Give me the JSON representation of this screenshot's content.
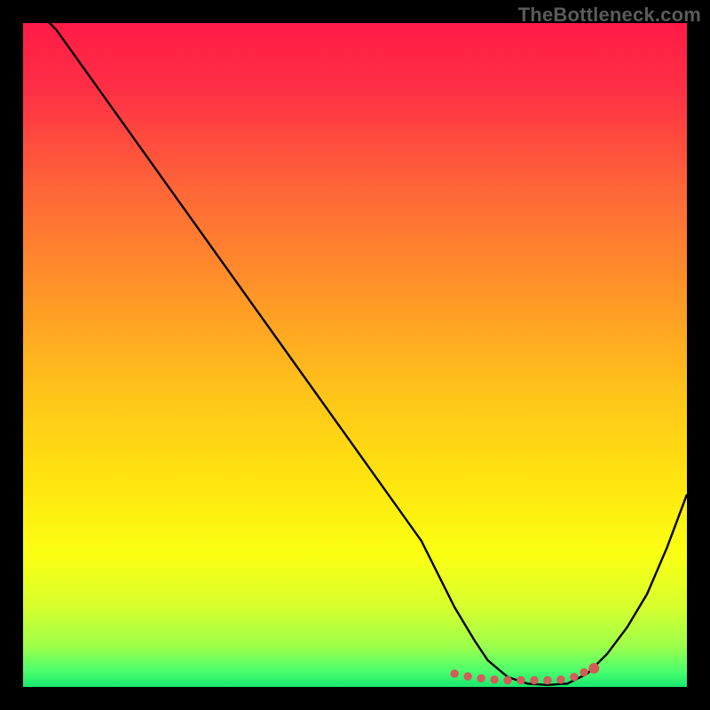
{
  "watermark": "TheBottleneck.com",
  "chart_data": {
    "type": "line",
    "title": "",
    "xlabel": "",
    "ylabel": "",
    "xlim": [
      0,
      100
    ],
    "ylim": [
      0,
      100
    ],
    "series": [
      {
        "name": "bottleneck-curve",
        "x": [
          0,
          5,
          10,
          15,
          20,
          25,
          30,
          35,
          40,
          45,
          50,
          55,
          60,
          63,
          65,
          68,
          70,
          73,
          76,
          79,
          82,
          85,
          88,
          91,
          94,
          97,
          100
        ],
        "y": [
          104,
          99,
          92,
          85,
          78,
          71,
          64,
          57,
          50,
          43,
          36,
          29,
          22,
          16,
          12,
          7,
          4,
          1.5,
          0.5,
          0.3,
          0.5,
          2,
          5,
          9,
          14,
          21,
          29
        ]
      }
    ],
    "optimal_band": {
      "x_start": 65,
      "x_end": 85,
      "y": 1.0
    },
    "markers": {
      "name": "optimal-range-markers",
      "x": [
        65,
        67,
        69,
        71,
        73,
        75,
        77,
        79,
        81,
        83,
        84.5,
        86
      ],
      "y": [
        2.0,
        1.6,
        1.3,
        1.1,
        1.0,
        1.0,
        1.0,
        1.0,
        1.1,
        1.5,
        2.2,
        2.8
      ]
    },
    "gradient_stops": [
      {
        "offset": 0.0,
        "color": "#ff1b47"
      },
      {
        "offset": 0.1,
        "color": "#ff2f45"
      },
      {
        "offset": 0.25,
        "color": "#ff6638"
      },
      {
        "offset": 0.4,
        "color": "#ff9328"
      },
      {
        "offset": 0.55,
        "color": "#ffc21a"
      },
      {
        "offset": 0.7,
        "color": "#ffe70f"
      },
      {
        "offset": 0.8,
        "color": "#faff12"
      },
      {
        "offset": 0.88,
        "color": "#d7ff2e"
      },
      {
        "offset": 0.94,
        "color": "#9bff4b"
      },
      {
        "offset": 0.975,
        "color": "#4dff6c"
      },
      {
        "offset": 1.0,
        "color": "#17e86f"
      }
    ],
    "colors": {
      "curve": "#000000",
      "marker_fill": "#d55b59",
      "marker_stroke": "#d55b59",
      "background_outer": "#000000"
    }
  }
}
